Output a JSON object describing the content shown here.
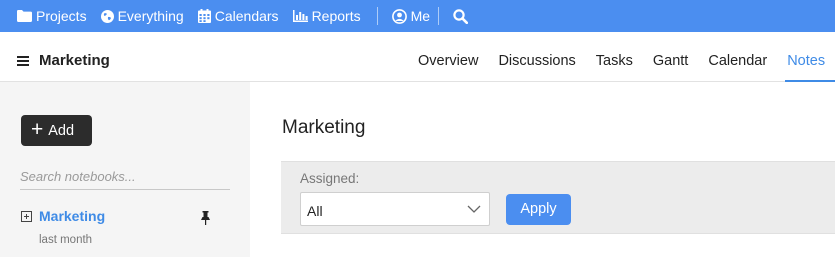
{
  "topnav": {
    "items": [
      {
        "label": "Projects",
        "icon": "folder-icon"
      },
      {
        "label": "Everything",
        "icon": "globe-icon"
      },
      {
        "label": "Calendars",
        "icon": "calendar-icon"
      },
      {
        "label": "Reports",
        "icon": "bar-chart-icon"
      }
    ],
    "user": {
      "label": "Me",
      "icon": "user-circle-icon"
    },
    "search_icon": "search-icon",
    "color": "#4b8ef0"
  },
  "header": {
    "title": "Marketing",
    "tabs": [
      {
        "label": "Overview"
      },
      {
        "label": "Discussions"
      },
      {
        "label": "Tasks"
      },
      {
        "label": "Gantt"
      },
      {
        "label": "Calendar"
      },
      {
        "label": "Notes",
        "active": true
      }
    ],
    "accent": "#3f8be6"
  },
  "sidebar": {
    "add_label": "Add",
    "search_placeholder": "Search notebooks...",
    "notebooks": [
      {
        "title": "Marketing",
        "updated": "last month",
        "pinned": true
      }
    ]
  },
  "main": {
    "title": "Marketing",
    "filter": {
      "label": "Assigned:",
      "value": "All",
      "apply_label": "Apply"
    }
  }
}
